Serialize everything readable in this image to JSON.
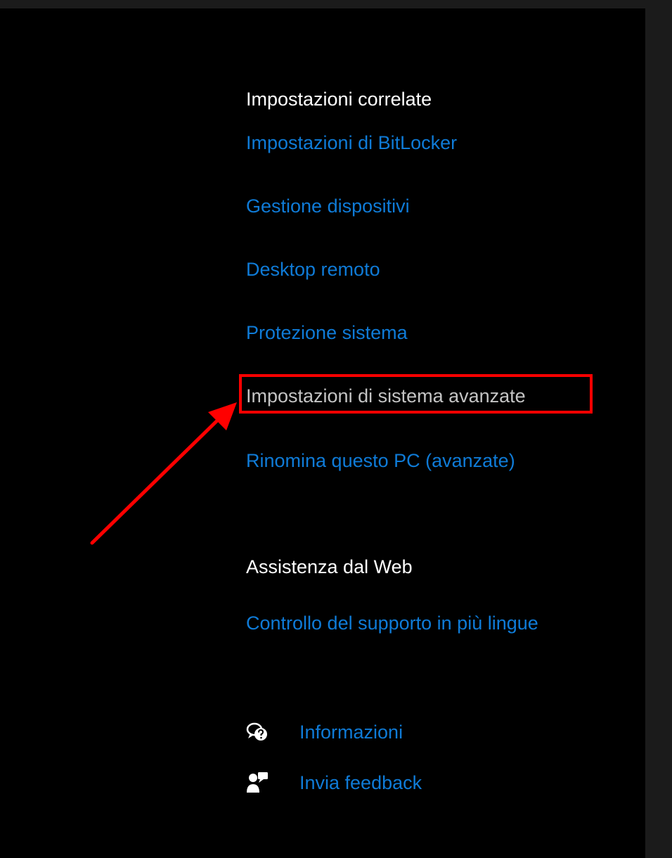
{
  "related_settings": {
    "heading": "Impostazioni correlate",
    "links": [
      "Impostazioni di BitLocker",
      "Gestione dispositivi",
      "Desktop remoto",
      "Protezione sistema",
      "Impostazioni di sistema avanzate",
      "Rinomina questo PC (avanzate)"
    ]
  },
  "web_help": {
    "heading": "Assistenza dal Web",
    "links": [
      "Controllo del supporto in più lingue"
    ]
  },
  "footer": {
    "info_label": "Informazioni",
    "info_icon": "help-chat-icon",
    "feedback_label": "Invia feedback",
    "feedback_icon": "feedback-person-icon"
  },
  "colors": {
    "link": "#0f7bd7",
    "heading": "#ffffff",
    "hovered_link": "#c4c4c4",
    "annotation": "#ff0000",
    "panel_background": "#000000",
    "window_background": "#1b1b1b"
  },
  "annotation": {
    "highlighted_item": "Impostazioni di sistema avanzate",
    "icon": "red-arrow-icon"
  }
}
